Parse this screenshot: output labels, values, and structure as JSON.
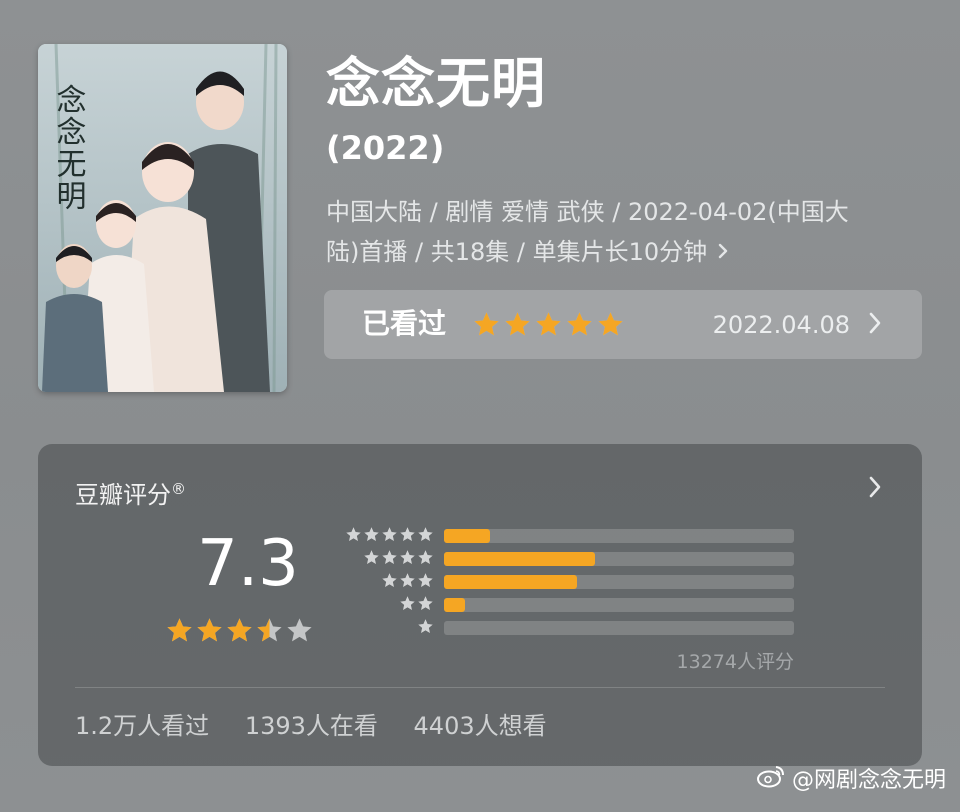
{
  "movie": {
    "title": "念念无明",
    "year": "(2022)",
    "meta_line1": "中国大陆 / 剧情 爱情 武侠 / 2022-04-02(中国大",
    "meta_line2": "陆)首播 / 共18集 / 单集片长10分钟",
    "poster_text": "念念无明"
  },
  "watched": {
    "label": "已看过",
    "my_rating": 5,
    "date": "2022.04.08"
  },
  "douban": {
    "title": "豆瓣评分",
    "registered": "®",
    "score": "7.3",
    "score_value": 7.3,
    "star_fill": 3.5,
    "distribution": [
      {
        "stars": 5,
        "fraction": 0.13
      },
      {
        "stars": 4,
        "fraction": 0.43
      },
      {
        "stars": 3,
        "fraction": 0.38
      },
      {
        "stars": 2,
        "fraction": 0.06
      },
      {
        "stars": 1,
        "fraction": 0.0
      }
    ],
    "count": "13274人评分",
    "stats": [
      "1.2万人看过",
      "1393人在看",
      "4403人想看"
    ]
  },
  "watermark": "@网剧念念无明",
  "colors": {
    "accent": "#f5a623",
    "star_empty": "#c4c6c7",
    "small_star": "#d3d5d6"
  }
}
